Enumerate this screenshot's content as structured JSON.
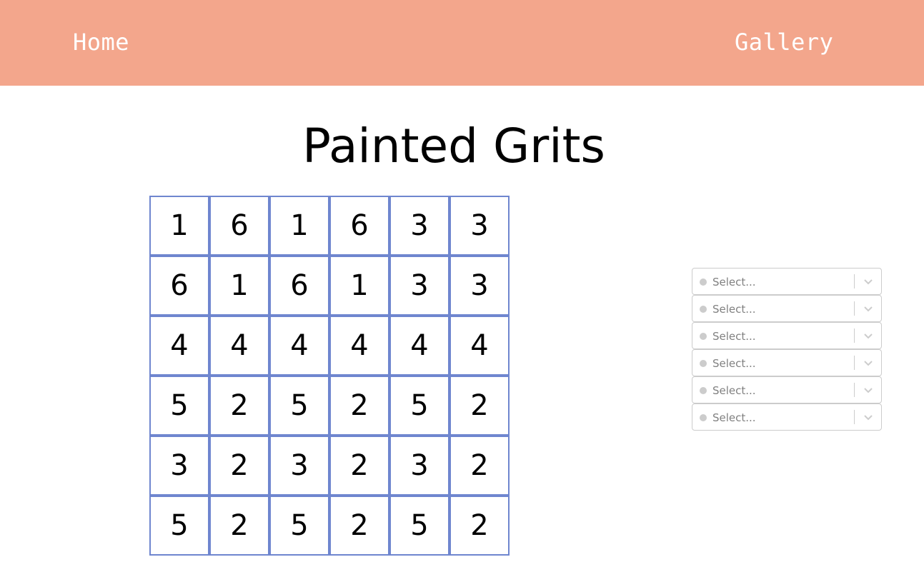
{
  "nav": {
    "home_label": "Home",
    "gallery_label": "Gallery"
  },
  "colors": {
    "navbar_bg": "#f3a68c",
    "grid_border": "#6f86cf",
    "select_placeholder": "#808080"
  },
  "main": {
    "title": "Painted Grits",
    "grid": [
      [
        "1",
        "6",
        "1",
        "6",
        "3",
        "3"
      ],
      [
        "6",
        "1",
        "6",
        "1",
        "3",
        "3"
      ],
      [
        "4",
        "4",
        "4",
        "4",
        "4",
        "4"
      ],
      [
        "5",
        "2",
        "5",
        "2",
        "5",
        "2"
      ],
      [
        "3",
        "2",
        "3",
        "2",
        "3",
        "2"
      ],
      [
        "5",
        "2",
        "5",
        "2",
        "5",
        "2"
      ]
    ]
  },
  "selects": [
    {
      "placeholder": "Select...",
      "icon": "chevron-down-icon"
    },
    {
      "placeholder": "Select...",
      "icon": "chevron-down-icon"
    },
    {
      "placeholder": "Select...",
      "icon": "chevron-down-icon"
    },
    {
      "placeholder": "Select...",
      "icon": "chevron-down-icon"
    },
    {
      "placeholder": "Select...",
      "icon": "chevron-down-icon"
    },
    {
      "placeholder": "Select...",
      "icon": "chevron-down-icon"
    }
  ]
}
